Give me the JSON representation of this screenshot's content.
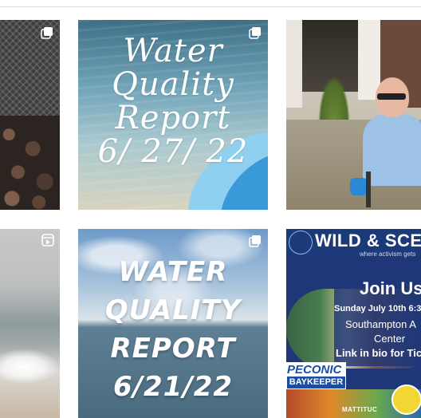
{
  "grid": {
    "posts": [
      {
        "id": "post-1",
        "kind": "multi-photo"
      },
      {
        "id": "post-2",
        "kind": "multi-photo",
        "text_lines": [
          "Water",
          "Quality",
          "Report",
          "6/ 27/ 22"
        ]
      },
      {
        "id": "post-3",
        "kind": "photo"
      },
      {
        "id": "post-4",
        "kind": "video"
      },
      {
        "id": "post-5",
        "kind": "multi-photo",
        "text_lines": [
          "WATER",
          "QUALITY",
          "REPORT",
          "6/21/22"
        ]
      },
      {
        "id": "post-6",
        "kind": "photo",
        "header_title": "WILD & SCENIC",
        "header_subtitle": "where activism gets",
        "join": "Join Us!",
        "date": "Sunday July 10th 6:3",
        "place": "Southampton A",
        "place2": "Center",
        "link": "Link in bio for Tick",
        "peconic": "PECONIC",
        "baykeeper": "BAYKEEPER",
        "mattituck": "MATTITUC"
      }
    ]
  },
  "icons": {
    "multi": "carousel-icon",
    "video": "reel-icon"
  },
  "colors": {
    "divider": "#dbdbdb",
    "poster_blue": "#1f3778",
    "baykeeper_blue": "#1b4ea3"
  }
}
